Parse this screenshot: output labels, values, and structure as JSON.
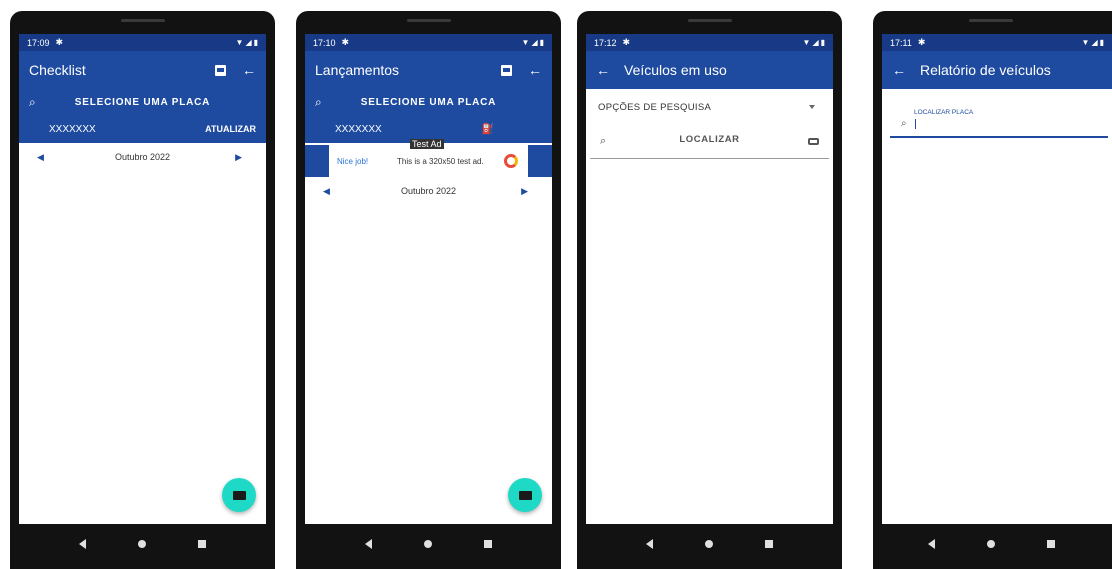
{
  "colors": {
    "primary": "#1e4ba0",
    "status": "#183a86",
    "fab": "#1dd9c6"
  },
  "phones": [
    {
      "time": "17:09",
      "title": "Checklist",
      "select_label": "SELECIONE UMA PLACA",
      "plate": "XXXXXXX",
      "update_label": "ATUALIZAR",
      "month": "Outubro 2022"
    },
    {
      "time": "17:10",
      "title": "Lançamentos",
      "select_label": "SELECIONE UMA PLACA",
      "plate": "XXXXXXX",
      "ad": {
        "tag": "Test Ad",
        "nice": "Nice job!",
        "text": "This is a 320x50 test ad."
      },
      "month": "Outubro 2022"
    },
    {
      "time": "17:12",
      "title": "Veículos em uso",
      "search_options": "OPÇÕES DE PESQUISA",
      "locate_label": "LOCALIZAR"
    },
    {
      "time": "17:11",
      "title": "Relatório de veículos",
      "plate_field_label": "LOCALIZAR PLACA"
    }
  ]
}
